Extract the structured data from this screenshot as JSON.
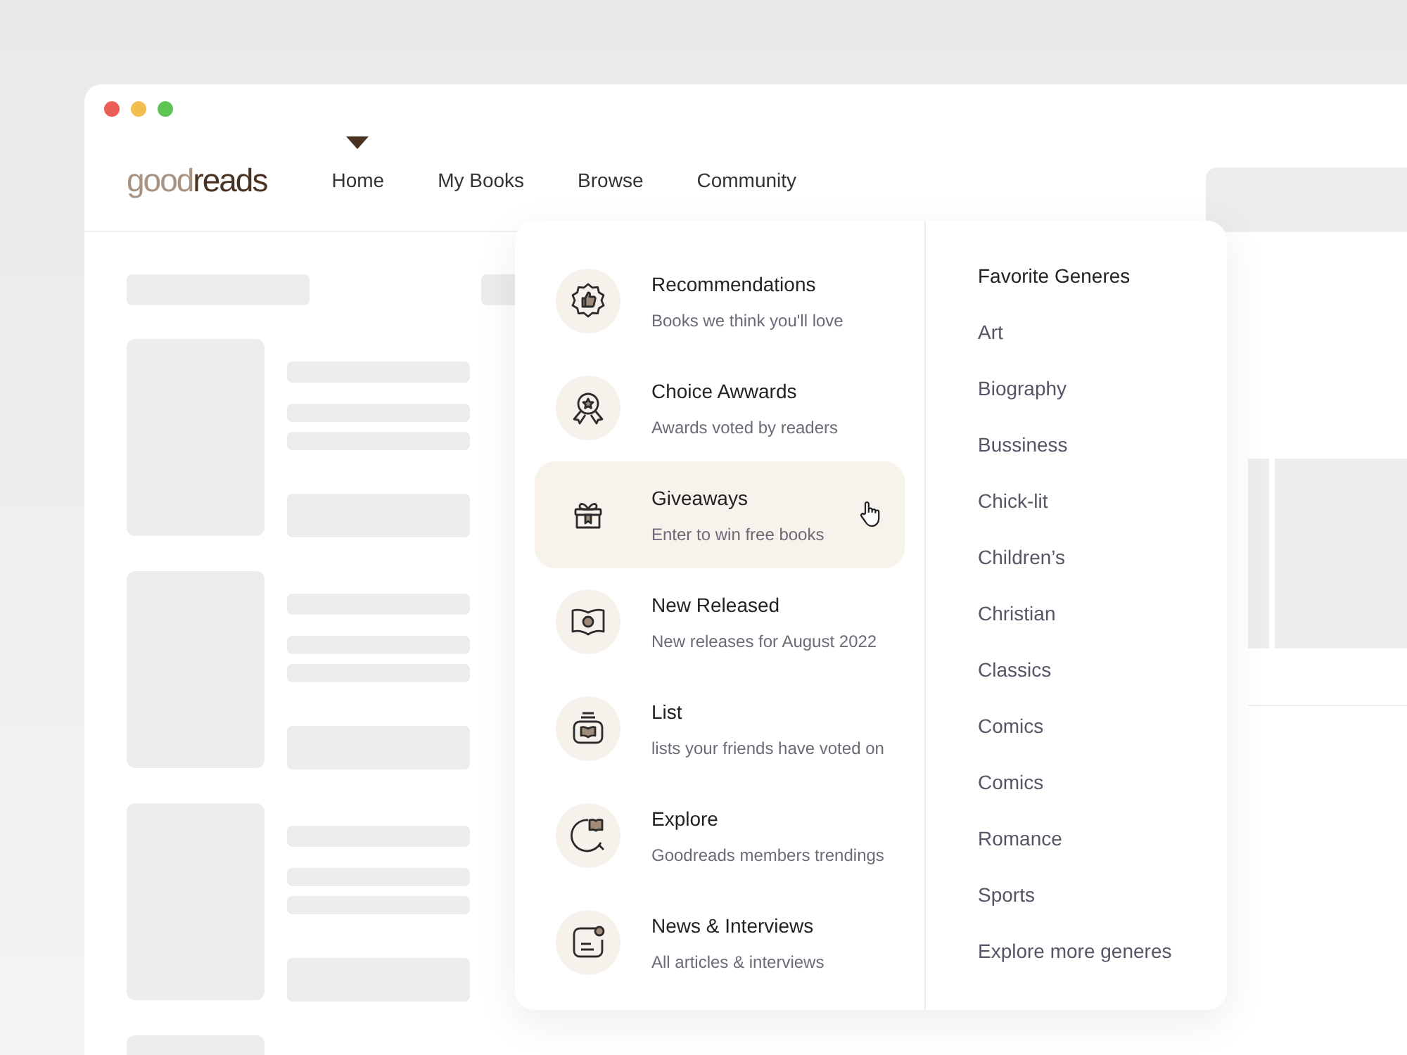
{
  "logo": {
    "light": "good",
    "dark": "reads"
  },
  "nav": [
    {
      "label": "Home",
      "selected": true
    },
    {
      "label": "My Books",
      "selected": false
    },
    {
      "label": "Browse",
      "selected": false
    },
    {
      "label": "Community",
      "selected": false
    }
  ],
  "browse_menu": {
    "items": [
      {
        "title": "Recommendations",
        "subtitle": "Books we think you'll love",
        "selected": false
      },
      {
        "title": "Choice Awwards",
        "subtitle": "Awards voted by readers",
        "selected": false
      },
      {
        "title": "Giveaways",
        "subtitle": "Enter to win free books",
        "selected": true
      },
      {
        "title": "New Released",
        "subtitle": "New releases for August 2022",
        "selected": false
      },
      {
        "title": "List",
        "subtitle": "lists your friends have voted on",
        "selected": false
      },
      {
        "title": "Explore",
        "subtitle": "Goodreads members trendings",
        "selected": false
      },
      {
        "title": "News & Interviews",
        "subtitle": "All articles & interviews",
        "selected": false
      }
    ],
    "genres": {
      "heading": "Favorite Generes",
      "items": [
        "Art",
        "Biography",
        "Bussiness",
        "Chick-lit",
        "Children’s",
        "Christian",
        "Classics",
        "Comics",
        "Comics",
        "Romance",
        "Sports",
        "Explore more generes"
      ]
    }
  }
}
